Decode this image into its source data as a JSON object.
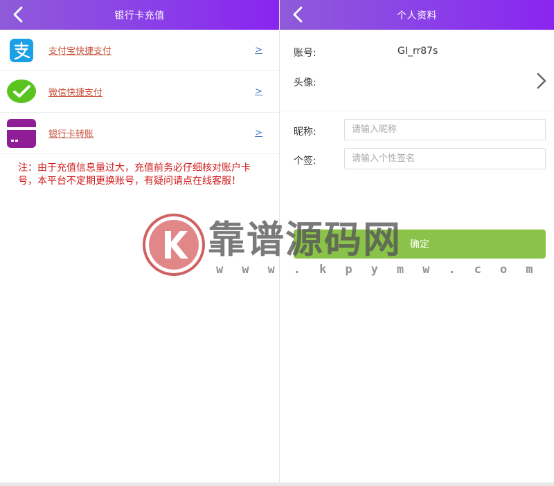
{
  "left": {
    "header": {
      "title": "银行卡充值"
    },
    "payments": [
      {
        "label": "支付宝快捷支付",
        "arrow": ">"
      },
      {
        "label": "微信快捷支付",
        "arrow": ">"
      },
      {
        "label": "银行卡转账",
        "arrow": ">"
      }
    ],
    "notice": "注：由于充值信息量过大，充值前务必仔细核对账户卡号，本平台不定期更换账号，有疑问请点在线客服！"
  },
  "right": {
    "header": {
      "title": "个人资料"
    },
    "account": {
      "label": "账号:",
      "value": "GI_rr87s"
    },
    "avatar": {
      "label": "头像:"
    },
    "nickname": {
      "label": "昵称:",
      "placeholder": "请输入昵称",
      "value": ""
    },
    "signature": {
      "label": "个签:",
      "placeholder": "请输入个性签名",
      "value": ""
    },
    "confirm_label": "确定"
  },
  "watermark": {
    "text": "靠谱源码网",
    "url": "w w w . k p y m w . c o m"
  },
  "colors": {
    "header_gradient_start": "#8f5bd9",
    "header_gradient_end": "#8a24f0",
    "alipay_blue": "#1aa0e6",
    "wechat_green": "#5bc31f",
    "bank_purple": "#8e1d96",
    "link_red": "#c8503a",
    "arrow_blue": "#3a78c4",
    "notice_red": "#d11b1b",
    "confirm_green": "#8bc34a"
  },
  "icons": {
    "back": "chevron-left-icon",
    "alipay": "alipay-icon",
    "wechat": "wechat-icon",
    "bank": "bank-card-icon",
    "avatar_chevron": "chevron-right-icon",
    "watermark_logo": "k-logo-icon"
  }
}
